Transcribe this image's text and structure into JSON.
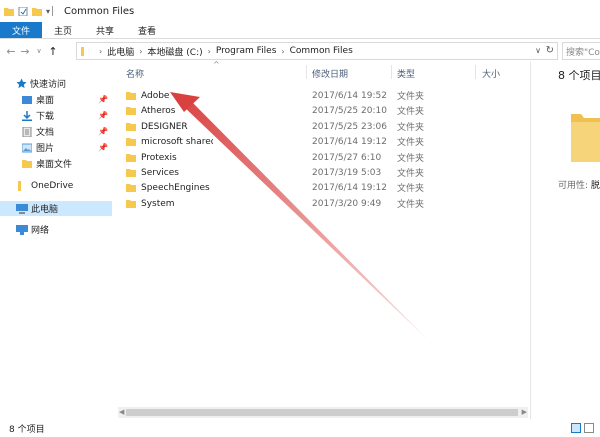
{
  "window": {
    "title": "Common Files"
  },
  "ribbon": {
    "tabs": [
      "文件",
      "主页",
      "共享",
      "查看"
    ]
  },
  "address": {
    "crumbs": [
      "此电脑",
      "本地磁盘 (C:)",
      "Program Files",
      "Common Files"
    ],
    "search_placeholder": "搜索\"Co"
  },
  "nav": {
    "quick_access": "快速访问",
    "items": [
      {
        "label": "桌面",
        "icon": "desktop-icon",
        "pinned": true
      },
      {
        "label": "下载",
        "icon": "download-icon",
        "pinned": true
      },
      {
        "label": "文档",
        "icon": "documents-icon",
        "pinned": true
      },
      {
        "label": "图片",
        "icon": "pictures-icon",
        "pinned": true
      },
      {
        "label": "桌面文件",
        "icon": "folder-icon",
        "pinned": false
      }
    ],
    "onedrive": "OneDrive",
    "this_pc": "此电脑",
    "network": "网络"
  },
  "columns": {
    "name": "名称",
    "date": "修改日期",
    "type": "类型",
    "size": "大小"
  },
  "files": [
    {
      "name": "Adobe",
      "date": "2017/6/14 19:52",
      "type": "文件夹"
    },
    {
      "name": "Atheros",
      "date": "2017/5/25 20:10",
      "type": "文件夹"
    },
    {
      "name": "DESIGNER",
      "date": "2017/5/25 23:06",
      "type": "文件夹"
    },
    {
      "name": "microsoft shared",
      "date": "2017/6/14 19:12",
      "type": "文件夹"
    },
    {
      "name": "Protexis",
      "date": "2017/5/27 6:10",
      "type": "文件夹"
    },
    {
      "name": "Services",
      "date": "2017/3/19 5:03",
      "type": "文件夹"
    },
    {
      "name": "SpeechEngines",
      "date": "2017/6/14 19:12",
      "type": "文件夹"
    },
    {
      "name": "System",
      "date": "2017/3/20 9:49",
      "type": "文件夹"
    }
  ],
  "details": {
    "count": "8 个项目",
    "available_label": "可用性:",
    "available_value": "脱"
  },
  "status": {
    "count": "8 个项目"
  },
  "colors": {
    "accent": "#1979ca",
    "selection": "#cce8ff",
    "folder": "#f5c94e",
    "annotation_arrow": "#d94040"
  }
}
